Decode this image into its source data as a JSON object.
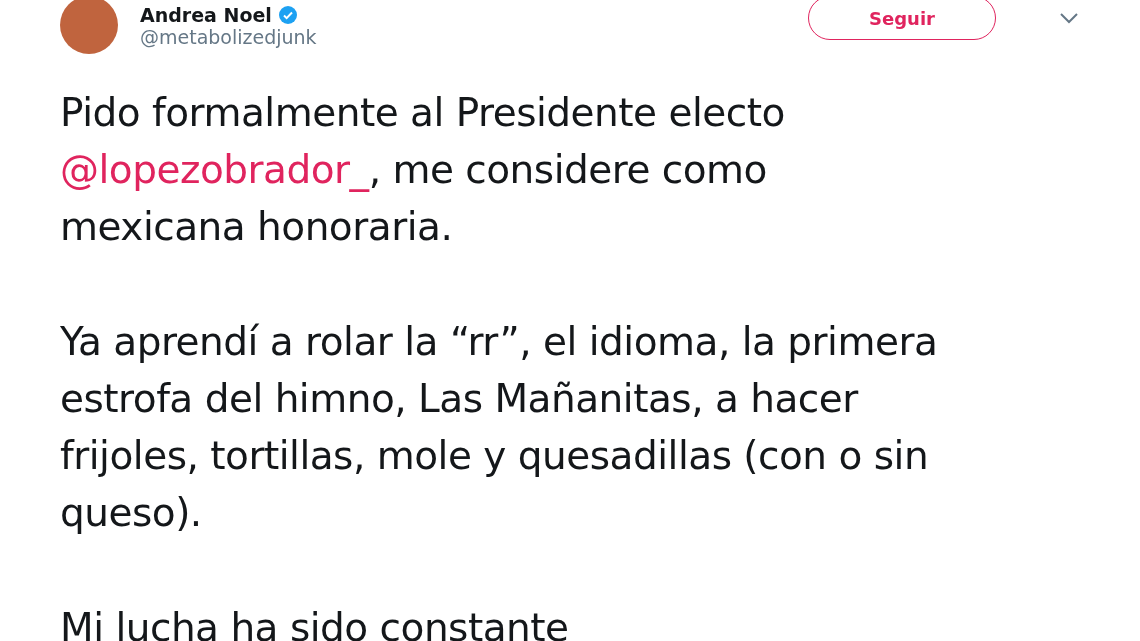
{
  "author": {
    "name": "Andrea Noel",
    "verified": true,
    "handle": "@metabolizedjunk"
  },
  "follow_button": {
    "label": "Seguir"
  },
  "tweet": {
    "paragraphs": [
      {
        "lines": [
          [
            {
              "kind": "text",
              "text": "Pido formalmente al Presidente electo"
            }
          ],
          [
            {
              "kind": "mention",
              "text": "@lopezobrador_"
            },
            {
              "kind": "text",
              "text": ", me considere como"
            }
          ],
          [
            {
              "kind": "text",
              "text": "mexicana honoraria."
            }
          ]
        ]
      },
      {
        "lines": [
          [
            {
              "kind": "text",
              "text": "Ya aprendí a rolar la “rr”, el idioma, la primera"
            }
          ],
          [
            {
              "kind": "text",
              "text": "estrofa del himno, Las Mañanitas, a hacer"
            }
          ],
          [
            {
              "kind": "text",
              "text": "frijoles, tortillas, mole y quesadillas (con o sin"
            }
          ],
          [
            {
              "kind": "text",
              "text": "queso)."
            }
          ]
        ]
      },
      {
        "lines": [
          [
            {
              "kind": "text",
              "text": "Mi lucha ha sido constante"
            }
          ]
        ]
      }
    ]
  }
}
